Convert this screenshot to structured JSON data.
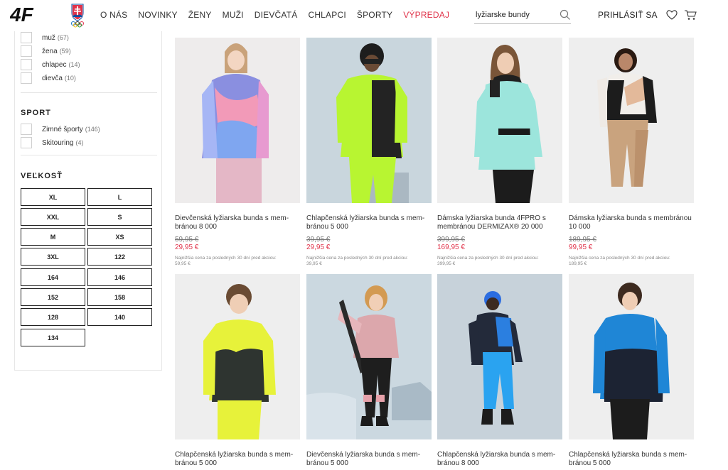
{
  "header": {
    "logo_text": "4F",
    "nav": [
      "O NÁS",
      "NOVINKY",
      "ŽENY",
      "MUŽI",
      "DIEVČATÁ",
      "CHLAPCI",
      "ŠPORTY",
      "VÝPREDAJ"
    ],
    "search_value": "lyžiarske bundy",
    "login_label": "PRIHLÁSIŤ SA",
    "sale_color": "#e0334a"
  },
  "sidebar": {
    "gender": [
      {
        "label": "muž",
        "count": "(67)"
      },
      {
        "label": "žena",
        "count": "(59)"
      },
      {
        "label": "chlapec",
        "count": "(14)"
      },
      {
        "label": "dievča",
        "count": "(10)"
      }
    ],
    "sport_title": "SPORT",
    "sport": [
      {
        "label": "Zimné športy",
        "count": "(146)"
      },
      {
        "label": "Skitouring",
        "count": "(4)"
      }
    ],
    "size_title": "VEĽKOSŤ",
    "sizes": [
      "XL",
      "L",
      "XXL",
      "S",
      "M",
      "XS",
      "3XL",
      "122",
      "164",
      "146",
      "152",
      "158",
      "128",
      "140",
      "134"
    ]
  },
  "lowest_label": "Najnižšia cena za posledných 30 dní pred akciou:",
  "products": [
    {
      "name": "Dievčenská lyžiarska bunda s mem-\nbránou 8 000",
      "old_price": "59,95 €",
      "new_price": "29,95 €",
      "lowest": "59,95 €"
    },
    {
      "name": "Chlapčenská lyžiarska bunda s mem-\nbránou 5 000",
      "old_price": "39,95 €",
      "new_price": "29,95 €",
      "lowest": "39,95 €"
    },
    {
      "name": "Dámska lyžiarska bunda 4FPRO s\nmembránou DERMIZAX® 20 000",
      "old_price": "399,95 €",
      "new_price": "169,95 €",
      "lowest": "399,95 €"
    },
    {
      "name": "Dámska lyžiarska bunda s membránou\n10 000",
      "old_price": "189,95 €",
      "new_price": "99,95 €",
      "lowest": "189,95 €"
    },
    {
      "name": "Chlapčenská lyžiarska bunda s mem-\nbránou 5 000"
    },
    {
      "name": "Dievčenská lyžiarska bunda s mem-\nbránou 5 000"
    },
    {
      "name": "Chlapčenská lyžiarska bunda s mem-\nbránou 8 000"
    },
    {
      "name": "Chlapčenská lyžiarska bunda s mem-\nbránou 5 000"
    }
  ]
}
